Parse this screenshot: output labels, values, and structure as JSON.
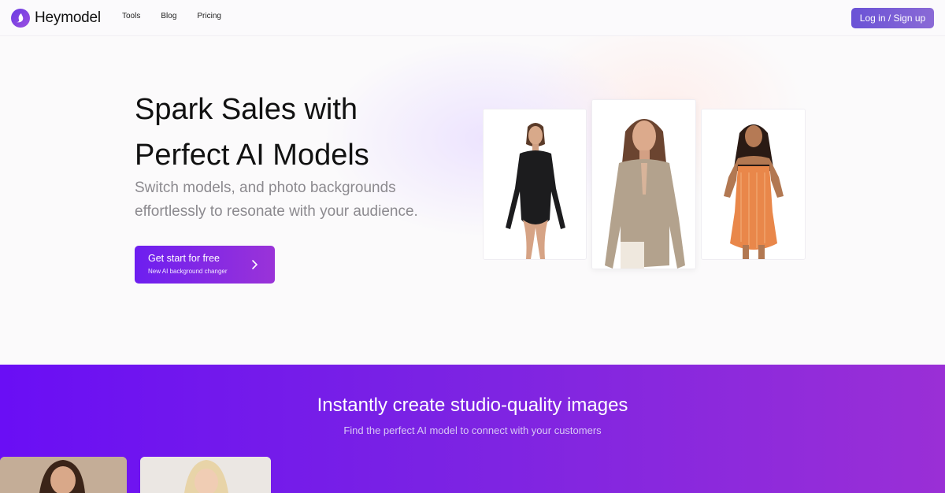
{
  "header": {
    "brand": "Heymodel",
    "nav": [
      "Tools",
      "Blog",
      "Pricing"
    ],
    "login_label": "Log in / Sign up"
  },
  "hero": {
    "title_line1": "Spark Sales with",
    "title_line2": "Perfect AI Models",
    "subtitle_line1": "Switch models, and photo backgrounds",
    "subtitle_line2": "effortlessly to resonate with your audience.",
    "cta_label": "Get start for free",
    "cta_sublabel": "New AI background changer",
    "cta_icon": "chevron-right-icon",
    "photos": [
      "model-black-bodysuit-photo",
      "model-beige-top-photo",
      "model-orange-dress-photo"
    ]
  },
  "section2": {
    "title": "Instantly create studio-quality images",
    "subtitle": "Find the perfect AI model to connect with your customers"
  },
  "colors": {
    "brand_purple": "#6d1ef0",
    "accent_violet": "#9a33d8",
    "login_button": "#6a52d6"
  }
}
